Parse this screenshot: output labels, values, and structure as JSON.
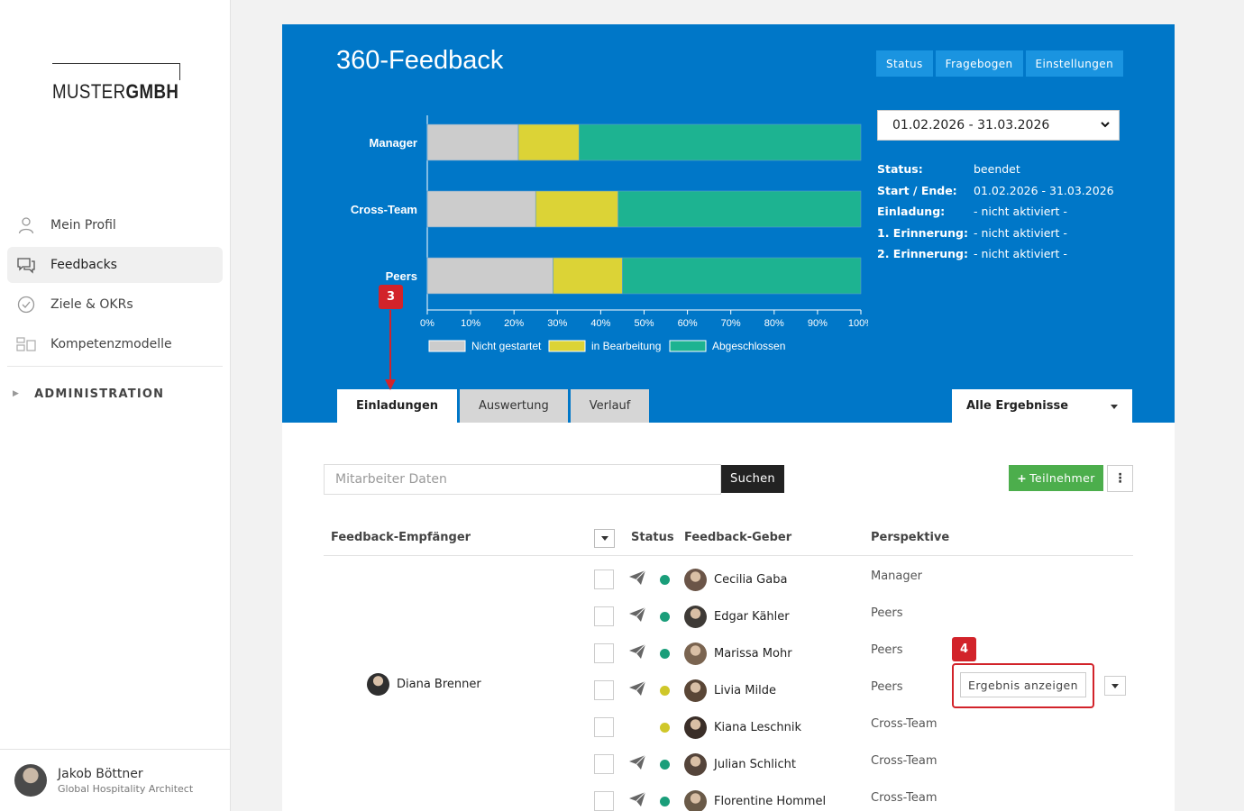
{
  "sidebar": {
    "logo_light": "MUSTER",
    "logo_bold": "GMBH",
    "items": [
      {
        "label": "Mein Profil",
        "icon": "user-icon"
      },
      {
        "label": "Feedbacks",
        "icon": "chat-icon"
      },
      {
        "label": "Ziele & OKRs",
        "icon": "check-circle-icon"
      },
      {
        "label": "Kompetenzmodelle",
        "icon": "grid-icon"
      }
    ],
    "admin_label": "ADMINISTRATION",
    "user": {
      "name": "Jakob Böttner",
      "role": "Global Hospitality Architect"
    }
  },
  "header": {
    "title": "360-Feedback",
    "buttons": [
      "Status",
      "Fragebogen",
      "Einstellungen"
    ],
    "date_range": "01.02.2026 - 31.03.2026",
    "info": [
      {
        "key": "Status:",
        "value": "beendet"
      },
      {
        "key": "Start / Ende:",
        "value": "01.02.2026 - 31.03.2026"
      },
      {
        "key": "Einladung:",
        "value": "- nicht aktiviert -"
      },
      {
        "key": "1. Erinnerung:",
        "value": "- nicht aktiviert -"
      },
      {
        "key": "2. Erinnerung:",
        "value": "- nicht aktiviert -"
      }
    ],
    "tabs": [
      "Einladungen",
      "Auswertung",
      "Verlauf"
    ],
    "results_dropdown": "Alle Ergebnisse"
  },
  "chart_data": {
    "type": "bar",
    "orientation": "horizontal",
    "stacked": true,
    "categories": [
      "Manager",
      "Cross-Team",
      "Peers"
    ],
    "series": [
      {
        "name": "Nicht gestartet",
        "values": [
          21,
          25,
          29
        ],
        "color": "#cccccc"
      },
      {
        "name": "in Bearbeitung",
        "values": [
          14,
          19,
          16
        ],
        "color": "#dcd336"
      },
      {
        "name": "Abgeschlossen",
        "values": [
          65,
          56,
          55
        ],
        "color": "#1db391"
      }
    ],
    "xlim": [
      0,
      100
    ],
    "xticks": [
      "0%",
      "10%",
      "20%",
      "30%",
      "40%",
      "50%",
      "60%",
      "70%",
      "80%",
      "90%",
      "100%"
    ],
    "legend": "bottom"
  },
  "toolbar": {
    "search_placeholder": "Mitarbeiter Daten",
    "search_button": "Suchen",
    "add_button": "Teilnehmer",
    "more_button": "⋮"
  },
  "table": {
    "headers": {
      "recipient": "Feedback-Empfänger",
      "status": "Status",
      "giver": "Feedback-Geber",
      "perspective": "Perspektive"
    },
    "recipient": "Diana Brenner",
    "rows": [
      {
        "giver": "Cecilia Gaba",
        "perspective": "Manager",
        "status_color": "#1a9e7a",
        "sent": true
      },
      {
        "giver": "Edgar Kähler",
        "perspective": "Peers",
        "status_color": "#1a9e7a",
        "sent": true
      },
      {
        "giver": "Marissa Mohr",
        "perspective": "Peers",
        "status_color": "#1a9e7a",
        "sent": true
      },
      {
        "giver": "Livia Milde",
        "perspective": "Peers",
        "status_color": "#cfc729",
        "sent": true
      },
      {
        "giver": "Kiana Leschnik",
        "perspective": "Cross-Team",
        "status_color": "#cfc729",
        "sent": false
      },
      {
        "giver": "Julian Schlicht",
        "perspective": "Cross-Team",
        "status_color": "#1a9e7a",
        "sent": true
      },
      {
        "giver": "Florentine Hommel",
        "perspective": "Cross-Team",
        "status_color": "#1a9e7a",
        "sent": true
      }
    ],
    "result_button": "Ergebnis anzeigen"
  },
  "callouts": [
    "3",
    "4"
  ]
}
